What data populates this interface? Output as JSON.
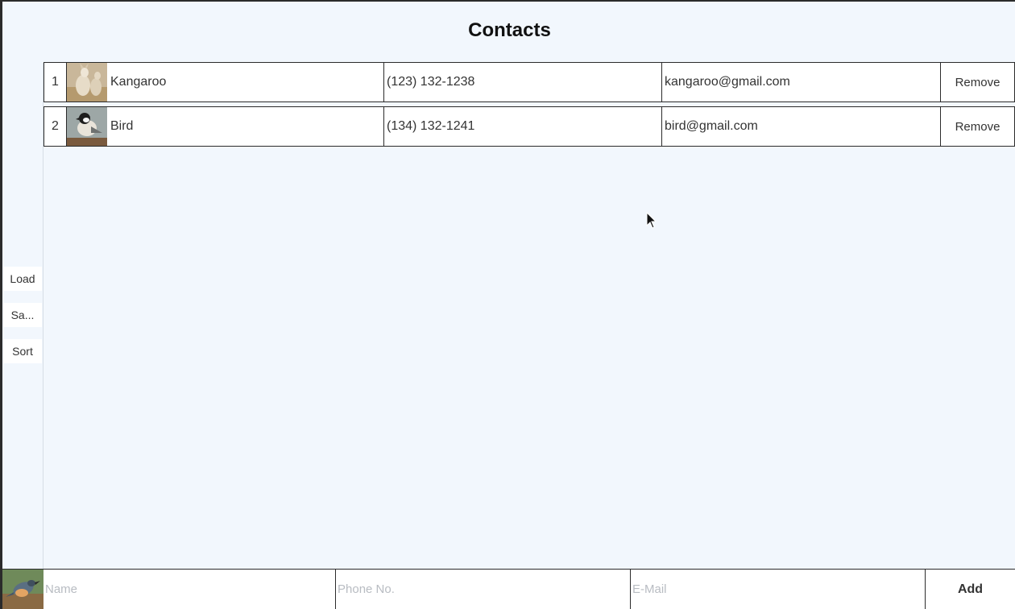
{
  "header": {
    "title": "Contacts"
  },
  "sidebar": {
    "load_label": "Load",
    "save_label": "Sa...",
    "sort_label": "Sort"
  },
  "contacts": [
    {
      "index": "1",
      "photo_icon": "kangaroo-photo",
      "name": "Kangaroo",
      "phone": "(123) 132-1238",
      "email": "kangaroo@gmail.com",
      "remove_label": "Remove"
    },
    {
      "index": "2",
      "photo_icon": "bird-photo",
      "name": "Bird",
      "phone": "(134) 132-1241",
      "email": "bird@gmail.com",
      "remove_label": "Remove"
    }
  ],
  "new_contact": {
    "photo_icon": "bird-photo",
    "name_placeholder": "Name",
    "phone_placeholder": "Phone No.",
    "email_placeholder": "E-Mail",
    "add_label": "Add"
  }
}
